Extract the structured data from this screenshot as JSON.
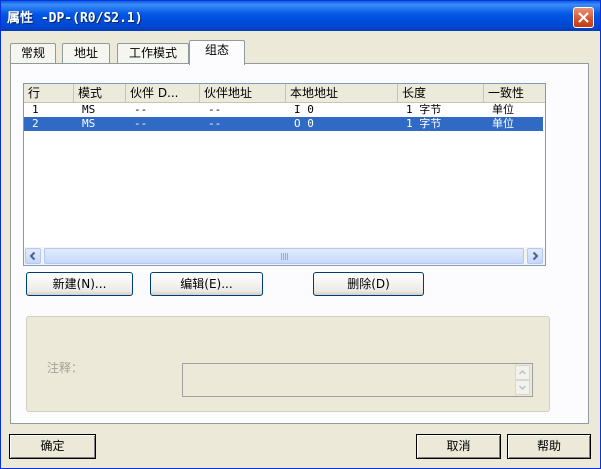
{
  "window": {
    "title": "属性 -DP-(R0/S2.1)"
  },
  "tabs": [
    {
      "label": "常规"
    },
    {
      "label": "地址"
    },
    {
      "label": "工作模式"
    },
    {
      "label": "组态"
    }
  ],
  "table": {
    "columns": [
      "行",
      "模式",
      "伙伴 D...",
      "伙伴地址",
      "本地地址",
      "长度",
      "一致性"
    ],
    "rows": [
      {
        "row": "1",
        "mode": "MS",
        "partner_dp": "--",
        "partner_addr": "--",
        "local_addr": "I 0",
        "length": "1 字节",
        "consistency": "单位"
      },
      {
        "row": "2",
        "mode": "MS",
        "partner_dp": "--",
        "partner_addr": "--",
        "local_addr": "O 0",
        "length": "1 字节",
        "consistency": "单位"
      }
    ],
    "selected_row": 2
  },
  "buttons": {
    "new": "新建(N)...",
    "edit": "编辑(E)...",
    "delete": "删除(D)",
    "ok": "确定",
    "cancel": "取消",
    "help": "帮助"
  },
  "note": {
    "label": "注释：",
    "value": ""
  },
  "colors": {
    "titlebar": "#0054e3",
    "selection": "#316ac5",
    "dialog": "#ece9d8"
  },
  "icons": [
    "close-icon",
    "scroll-left-icon",
    "scroll-right-icon",
    "scroll-up-icon",
    "scroll-down-icon"
  ]
}
